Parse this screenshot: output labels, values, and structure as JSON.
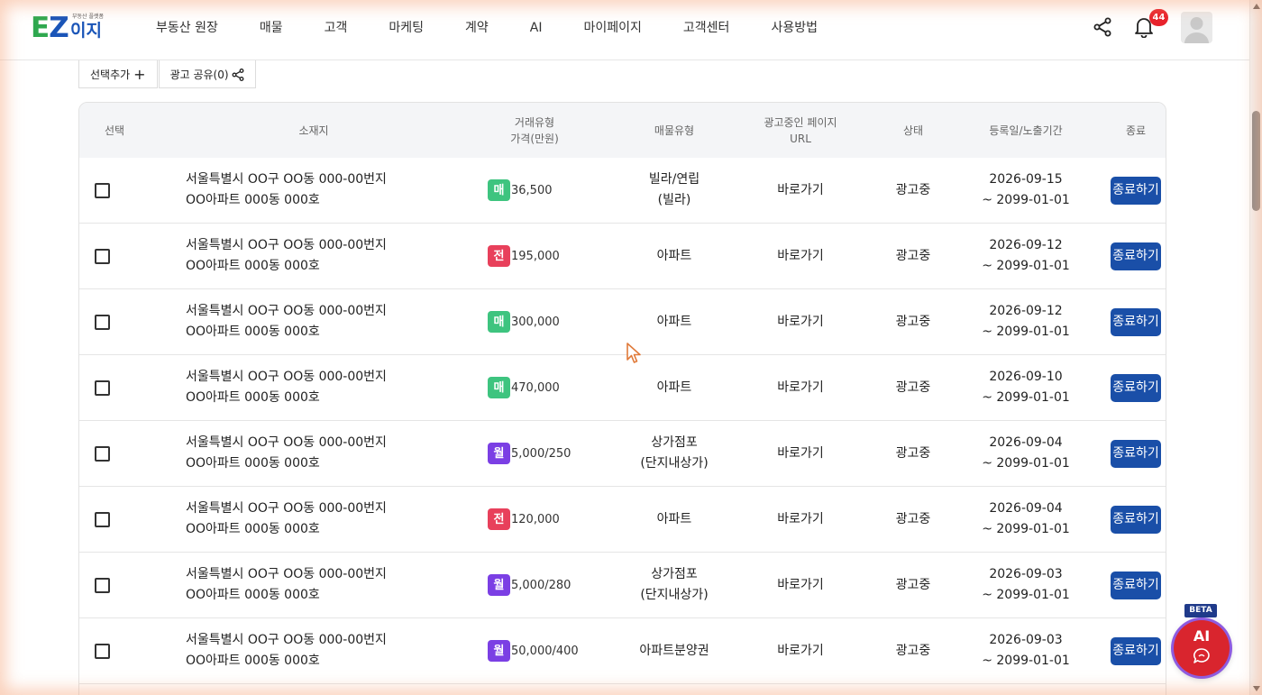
{
  "header": {
    "logo": {
      "text_ez_e": "E",
      "text_ez_z": "Z",
      "text_kr": "이지",
      "tagline": "부동산 플랫폼"
    },
    "nav": [
      "부동산 원장",
      "매물",
      "고객",
      "마케팅",
      "계약",
      "AI",
      "마이페이지",
      "고객센터",
      "사용방법"
    ],
    "notification_count": "44",
    "icons": {
      "share": "share-icon",
      "bell": "bell-icon",
      "avatar": "user-avatar-icon"
    }
  },
  "toolbar": {
    "add_selected_label": "선택추가",
    "share_ads_label": "광고 공유(0)"
  },
  "table": {
    "headers": {
      "select": "선택",
      "location": "소재지",
      "deal": "거래유형\n가격(만원)",
      "property_type": "매물유형",
      "ad_page": "광고중인 페이지\nURL",
      "status": "상태",
      "period": "등록일/노출기간",
      "end": "종료"
    },
    "badge_colors": {
      "매": "#3ec47f",
      "전": "#e8405b",
      "월": "#7b3fe4"
    },
    "rows": [
      {
        "addr1": "서울특별시 OO구 OO동 000-00번지",
        "addr2": "OO아파트 000동 000호",
        "deal": "매",
        "price": "36,500",
        "type1": "빌라/연립",
        "type2": "(빌라)",
        "url": "바로가기",
        "status": "광고중",
        "date1": "2026-09-15",
        "date2": "~ 2099-01-01",
        "end": "종료하기"
      },
      {
        "addr1": "서울특별시 OO구 OO동 000-00번지",
        "addr2": "OO아파트 000동 000호",
        "deal": "전",
        "price": "195,000",
        "type1": "아파트",
        "type2": "",
        "url": "바로가기",
        "status": "광고중",
        "date1": "2026-09-12",
        "date2": "~ 2099-01-01",
        "end": "종료하기"
      },
      {
        "addr1": "서울특별시 OO구 OO동 000-00번지",
        "addr2": "OO아파트 000동 000호",
        "deal": "매",
        "price": "300,000",
        "type1": "아파트",
        "type2": "",
        "url": "바로가기",
        "status": "광고중",
        "date1": "2026-09-12",
        "date2": "~ 2099-01-01",
        "end": "종료하기"
      },
      {
        "addr1": "서울특별시 OO구 OO동 000-00번지",
        "addr2": "OO아파트 000동 000호",
        "deal": "매",
        "price": "470,000",
        "type1": "아파트",
        "type2": "",
        "url": "바로가기",
        "status": "광고중",
        "date1": "2026-09-10",
        "date2": "~ 2099-01-01",
        "end": "종료하기"
      },
      {
        "addr1": "서울특별시 OO구 OO동 000-00번지",
        "addr2": "OO아파트 000동 000호",
        "deal": "월",
        "price": "5,000/250",
        "type1": "상가점포",
        "type2": "(단지내상가)",
        "url": "바로가기",
        "status": "광고중",
        "date1": "2026-09-04",
        "date2": "~ 2099-01-01",
        "end": "종료하기"
      },
      {
        "addr1": "서울특별시 OO구 OO동 000-00번지",
        "addr2": "OO아파트 000동 000호",
        "deal": "전",
        "price": "120,000",
        "type1": "아파트",
        "type2": "",
        "url": "바로가기",
        "status": "광고중",
        "date1": "2026-09-04",
        "date2": "~ 2099-01-01",
        "end": "종료하기"
      },
      {
        "addr1": "서울특별시 OO구 OO동 000-00번지",
        "addr2": "OO아파트 000동 000호",
        "deal": "월",
        "price": "5,000/280",
        "type1": "상가점포",
        "type2": "(단지내상가)",
        "url": "바로가기",
        "status": "광고중",
        "date1": "2026-09-03",
        "date2": "~ 2099-01-01",
        "end": "종료하기"
      },
      {
        "addr1": "서울특별시 OO구 OO동 000-00번지",
        "addr2": "OO아파트 000동 000호",
        "deal": "월",
        "price": "50,000/400",
        "type1": "아파트분양권",
        "type2": "",
        "url": "바로가기",
        "status": "광고중",
        "date1": "2026-09-03",
        "date2": "~ 2099-01-01",
        "end": "종료하기"
      }
    ]
  },
  "ai_assistant": {
    "label": "AI",
    "beta": "BETA",
    "color": "#d9252e"
  }
}
